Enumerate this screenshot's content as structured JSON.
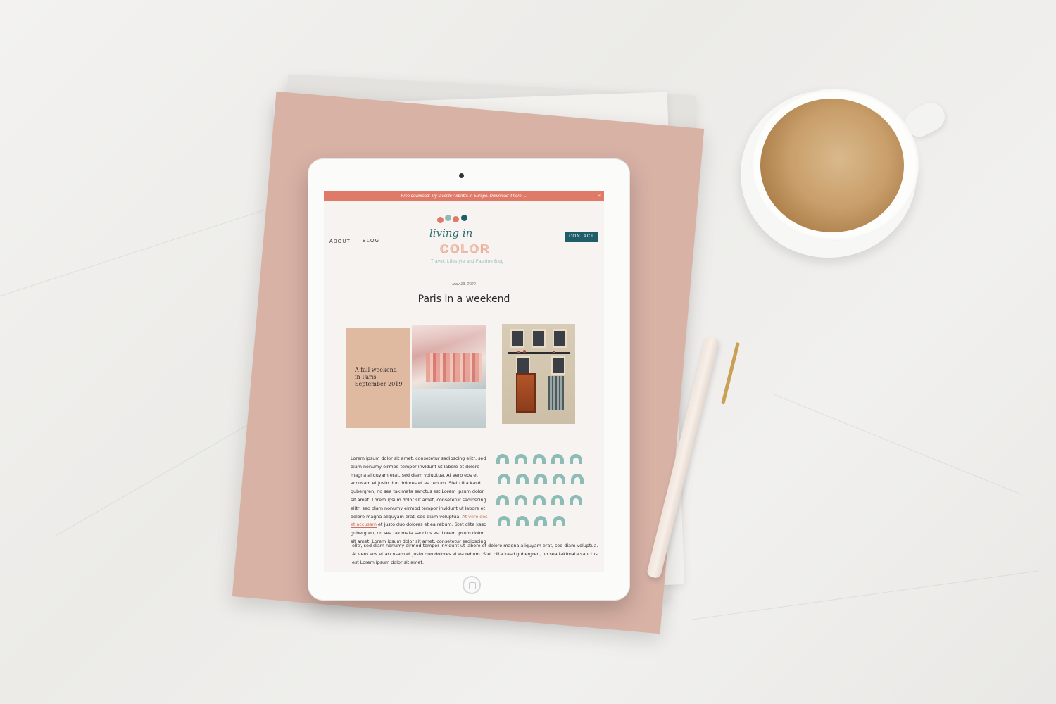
{
  "announcement": {
    "text": "Free download: My favorite Airbnb's in Europe. Download it here →",
    "close": "×"
  },
  "nav": {
    "about": "ABOUT",
    "blog": "BLOG",
    "contact": "CONTACT"
  },
  "logo": {
    "script": "living in",
    "word": "COLOR",
    "tagline": "Travel, Lifestyle and Fashion Blog",
    "dot_colors": [
      "#e07a68",
      "#8fb9b6",
      "#1f5e68",
      "#f2c7b6"
    ]
  },
  "post": {
    "date": "May 13, 2020",
    "title": "Paris in a weekend",
    "card_text": "A fall weekend in Paris - September 2019",
    "body_part1": "Lorem ipsum dolor sit amet, consetetur sadipscing elitr, sed diam nonumy eirmod tempor invidunt ut labore et dolore magna aliquyam erat, sed diam voluptua. At vero eos et accusam et justo duo dolores et ea rebum. Stet clita kasd gubergren, no sea takimata sanctus est Lorem ipsum dolor sit amet. Lorem ipsum dolor sit amet, consetetur sadipscing elitr, sed diam nonumy eirmod tempor invidunt ut labore et dolore magna aliquyam erat, sed diam voluptua.",
    "body_link": "At vero eos et accusam",
    "body_part2": "et justo duo dolores et ea rebum. Stet clita kasd gubergren, no sea takimata sanctus est Lorem ipsum dolor sit amet. Lorem ipsum dolor sit amet, consetetur sadipscing",
    "body_full": "elitr, sed diam nonumy eirmod tempor invidunt ut labore et dolore magna aliquyam erat, sed diam voluptua. At vero eos et accusam et justo duo dolores et ea rebum. Stet clita kasd gubergren, no sea takimata sanctus est Lorem ipsum dolor sit amet."
  },
  "colors": {
    "accent_coral": "#e07a68",
    "teal": "#1f5e68",
    "mint": "#8dbbb6",
    "blush": "#e0b9a1"
  }
}
